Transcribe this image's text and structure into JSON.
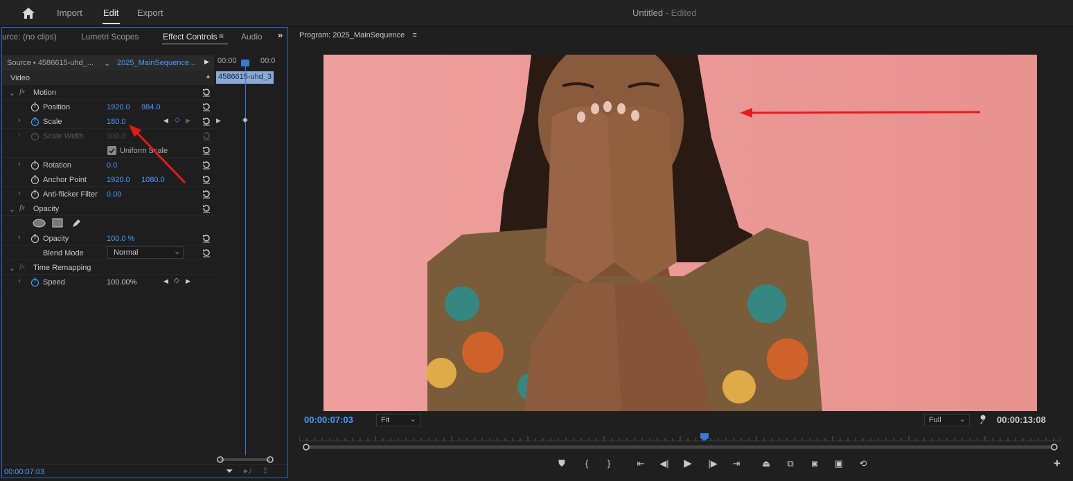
{
  "topbar": {
    "nav": [
      "Import",
      "Edit",
      "Export"
    ],
    "active_nav": "Edit",
    "doc_title": "Untitled",
    "doc_status": "- Edited"
  },
  "left_panel": {
    "tabs": [
      "urce: (no clips)",
      "Lumetri Scopes",
      "Effect Controls",
      "Audio"
    ],
    "active_tab": "Effect Controls",
    "source_label": "Source • 4586615-uhd_...",
    "sequence_label": "2025_MainSequence...",
    "timeline_times": [
      "00:00",
      "00:0"
    ],
    "clip_label": "4586615-uhd_3",
    "section_video": "Video",
    "motion": {
      "label": "Motion",
      "position": {
        "label": "Position",
        "x": "1920.0",
        "y": "984.0"
      },
      "scale": {
        "label": "Scale",
        "value": "180.0"
      },
      "scale_width": {
        "label": "Scale Width",
        "value": "100.0"
      },
      "uniform_scale": {
        "label": "Uniform Scale",
        "checked": true
      },
      "rotation": {
        "label": "Rotation",
        "value": "0.0"
      },
      "anchor_point": {
        "label": "Anchor Point",
        "x": "1920.0",
        "y": "1080.0"
      },
      "anti_flicker": {
        "label": "Anti-flicker Filter",
        "value": "0.00"
      }
    },
    "opacity": {
      "label": "Opacity",
      "opacity": {
        "label": "Opacity",
        "value": "100.0 %"
      },
      "blend_mode": {
        "label": "Blend Mode",
        "value": "Normal"
      }
    },
    "time_remapping": {
      "label": "Time Remapping",
      "speed": {
        "label": "Speed",
        "value": "100.00%"
      }
    },
    "bottom_timecode": "00:00:07:03"
  },
  "program": {
    "title": "Program: 2025_MainSequence",
    "current_time": "00:00:07:03",
    "fit": "Fit",
    "quality": "Full",
    "duration": "00:00:13:08",
    "playhead_fraction": 0.53
  },
  "colors": {
    "accent": "#4a9bff",
    "annotation_arrow": "#e8191c",
    "video_bg": "#ec9c9a"
  }
}
